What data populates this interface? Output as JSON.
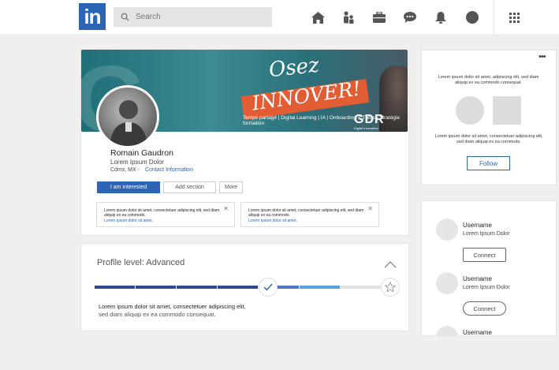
{
  "topbar": {
    "logo_text": "in",
    "search_placeholder": "Search",
    "nav_icons": [
      "home-icon",
      "network-icon",
      "jobs-icon",
      "messaging-icon",
      "notifications-icon",
      "profile-icon",
      "apps-grid-icon"
    ]
  },
  "profile": {
    "banner": {
      "headline_top": "Osez",
      "headline_bottom": "INNOVER!",
      "tagline": "Temps partagé | Digital Learning | IA | Onboarding & Tutos | Stratégie formation",
      "brand": "GDR",
      "brand_sub": "Digital Innovation"
    },
    "name": "Romain Gaudron",
    "headline": "Lorem Ipsum Dolor",
    "location": "Cdmx, MX -",
    "contact_label": "Contact Information",
    "buttons": {
      "interested": "I am interested",
      "add_section": "Add section",
      "more": "More"
    },
    "notices": [
      {
        "text": "Lorem ipsum dolor sit amet, consectetuer adipiscing elit, sed diam aliquip ex ea commodo.",
        "link": "Lorem Ipsum dolor sit amet."
      },
      {
        "text": "Lorem ipsum dolor sit amet, consectetuer adipiscing elit, sed diam aliquip ex ea commodo.",
        "link": "Lorem Ipsum dolor sit amet."
      }
    ]
  },
  "progress": {
    "title": "Profile level: Advanced",
    "completed_fraction": 0.62,
    "line1": "Lorem ipsum dolor sit amet, consectetuer adipiscing elit,",
    "line2": "sed diam aliquip ex ea commodo consequat.",
    "colors": {
      "done": "#2c4a8c",
      "next": "#4a78c4",
      "light": "#5aa0dc",
      "empty": "#e2e2e2"
    }
  },
  "company_card": {
    "text_top": "Lorem ipsum dolor sit amet, adipiscing elit, sed diam aliquip ex ea commodo consequat.",
    "text_bottom": "Lorem ipsum dolor sit amet, consectetuer adipiscing elit, sed diam aliquip ex ea commodo.",
    "follow_label": "Follow"
  },
  "suggestions": [
    {
      "name": "Username",
      "subtitle": "Lorem Ipsum Dolor",
      "button": "Connect"
    },
    {
      "name": "Username",
      "subtitle": "Lorem Ipsum Dolor",
      "button": "Connect"
    },
    {
      "name": "Username"
    }
  ],
  "colors": {
    "brand_blue": "#2d64b3",
    "background": "#f0efed"
  }
}
